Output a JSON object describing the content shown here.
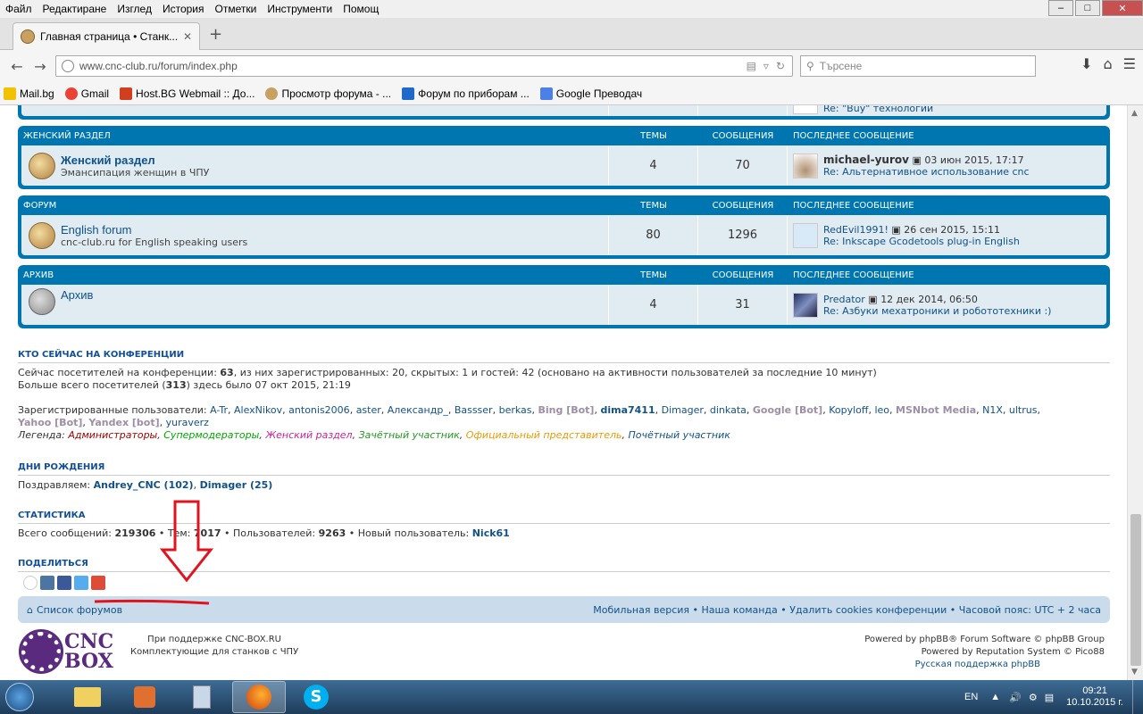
{
  "menubar": {
    "items": [
      "Файл",
      "Редактиране",
      "Изглед",
      "История",
      "Отметки",
      "Инструменти",
      "Помощ"
    ]
  },
  "browser": {
    "tab_title": "Главная страница • Станк...",
    "url": "www.cnc-club.ru/forum/index.php",
    "search_placeholder": "Търсене"
  },
  "bookmarks": [
    "Mail.bg",
    "Gmail",
    "Host.BG Webmail :: До...",
    "Просмотр форума - ...",
    "Форум по приборам ...",
    "Google Преводач"
  ],
  "partial_row": {
    "text": "Re: \"Buy\" технологии"
  },
  "forums": [
    {
      "category": "ЖЕНСКИЙ РАЗДЕЛ",
      "col_topics": "ТЕМЫ",
      "col_posts": "СООБЩЕНИЯ",
      "col_last": "ПОСЛЕДНЕЕ СООБЩЕНИЕ",
      "title": "Женский раздел",
      "desc": "Эмансипация женщин в ЧПУ",
      "topics": "4",
      "posts": "70",
      "last_user": "michael-yurov",
      "last_date": "03 июн 2015, 17:17",
      "last_subject": "Re: Альтернативное использование cnc"
    },
    {
      "category": "ФОРУМ",
      "col_topics": "ТЕМЫ",
      "col_posts": "СООБЩЕНИЯ",
      "col_last": "ПОСЛЕДНЕЕ СООБЩЕНИЕ",
      "title": "English forum",
      "desc": "cnc-club.ru for English speaking users",
      "topics": "80",
      "posts": "1296",
      "last_user": "RedEvil1991!",
      "last_date": "26 сен 2015, 15:11",
      "last_subject": "Re: Inkscape Gcodetools plug-in English"
    },
    {
      "category": "АРХИВ",
      "col_topics": "ТЕМЫ",
      "col_posts": "СООБЩЕНИЯ",
      "col_last": "ПОСЛЕДНЕЕ СООБЩЕНИЕ",
      "title": "Архив",
      "desc": "",
      "topics": "4",
      "posts": "31",
      "last_user": "Predator",
      "last_date": "12 дек 2014, 06:50",
      "last_subject": "Re: Азбуки мехатроники и робототехники :)"
    }
  ],
  "online": {
    "heading": "КТО СЕЙЧАС НА КОНФЕРЕНЦИИ",
    "line1_pre": "Сейчас посетителей на конференции: ",
    "line1_num": "63",
    "line1_post": ", из них зарегистрированных: 20, скрытых: 1 и гостей: 42 (основано на активности пользователей за последние 10 минут)",
    "line2_pre": "Больше всего посетителей (",
    "line2_num": "313",
    "line2_post": ") здесь было 07 окт 2015, 21:19",
    "registered_label": "Зарегистрированные пользователи: ",
    "users": [
      "A-Tr",
      "AlexNikov",
      "antonis2006",
      "aster",
      "Александр_",
      "Bassser",
      "berkas",
      "Bing [Bot]",
      "dima7411",
      "Dimager",
      "dinkata",
      "Google [Bot]",
      "Kopyloff",
      "leo",
      "MSNbot Media",
      "N1X",
      "ultrus",
      "Yahoo [Bot]",
      "Yandex [bot]",
      "yuraverz"
    ],
    "legend_label": "Легенда:",
    "legend": [
      "Администраторы",
      "Супермодераторы",
      "Женский раздел",
      "Зачётный участник",
      "Официальный представитель",
      "Почётный участник"
    ]
  },
  "birthdays": {
    "heading": "ДНИ РОЖДЕНИЯ",
    "pre": "Поздравляем: ",
    "user1": "Andrey_CNC (102)",
    "user2": "Dimager (25)"
  },
  "stats": {
    "heading": "СТАТИСТИКА",
    "l1": "Всего сообщений: ",
    "v1": "219306",
    "l2": " • Тем: ",
    "v2": "7017",
    "l3": " • Пользователей: ",
    "v3": "9263",
    "l4": " • Новый пользователь: ",
    "v4": "Nick61"
  },
  "share": {
    "heading": "ПОДЕЛИТЬСЯ"
  },
  "footer": {
    "index_link": "Список форумов",
    "links": "Мобильная версия • Наша команда • Удалить cookies конференции • Часовой пояс: UTC + 2 часа"
  },
  "copyright": {
    "logo1": "CNC",
    "logo2": "BOX",
    "support1": "При поддержке CNC-BOX.RU",
    "support2": "Комплектующие для станков с ЧПУ",
    "pow1": "Powered by phpBB® Forum Software © phpBB Group",
    "pow2": "Powered by Reputation System © Pico88",
    "pow3": "Русская поддержка phpBB"
  },
  "taskbar": {
    "lang": "EN",
    "time": "09:21",
    "date": "10.10.2015 г."
  },
  "colors": {
    "forum_header": "#0076b1",
    "row_bg": "#e1ebf2",
    "annotation": "#e0141e"
  }
}
